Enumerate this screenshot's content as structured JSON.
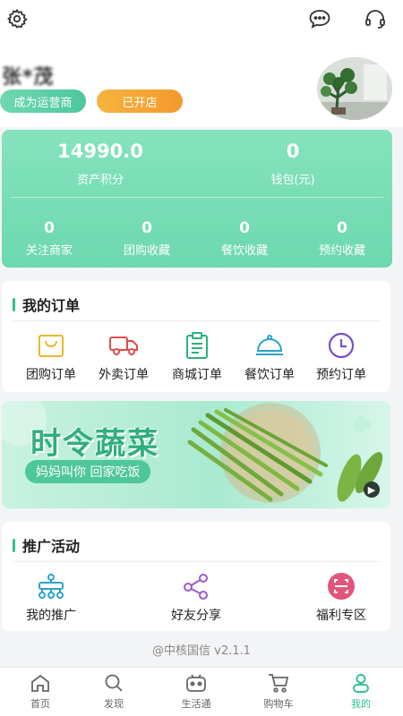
{
  "header": {
    "settings_icon": "gear-icon",
    "message_icon": "chat-bubble-icon",
    "service_icon": "headset-icon"
  },
  "profile": {
    "username": "张*茂",
    "operator_button": "成为运营商",
    "shop_button": "已开店",
    "avatar_icon": "avatar-photo"
  },
  "assets": {
    "points_value": "14990.0",
    "points_label": "资产积分",
    "wallet_value": "0",
    "wallet_label": "钱包(元)",
    "stats": [
      {
        "value": "0",
        "label": "关注商家"
      },
      {
        "value": "0",
        "label": "团购收藏"
      },
      {
        "value": "0",
        "label": "餐饮收藏"
      },
      {
        "value": "0",
        "label": "预约收藏"
      }
    ]
  },
  "orders": {
    "title": "我的订单",
    "items": [
      {
        "label": "团购订单",
        "icon": "shopping-bag-icon",
        "color": "#e8b82a"
      },
      {
        "label": "外卖订单",
        "icon": "delivery-truck-icon",
        "color": "#e24b4b"
      },
      {
        "label": "商城订单",
        "icon": "clipboard-icon",
        "color": "#2bb07b"
      },
      {
        "label": "餐饮订单",
        "icon": "food-cloche-icon",
        "color": "#2aa3c9"
      },
      {
        "label": "预约订单",
        "icon": "clock-icon",
        "color": "#7a4fd1"
      }
    ]
  },
  "banner": {
    "title": "时令蔬菜",
    "subtitle": "妈妈叫你 回家吃饭",
    "arrow_icon": "play-arrow-icon"
  },
  "promo": {
    "title": "推广活动",
    "items": [
      {
        "label": "我的推广",
        "icon": "network-icon",
        "color": "#2aa3c9"
      },
      {
        "label": "好友分享",
        "icon": "share-icon",
        "color": "#9b59d0"
      },
      {
        "label": "福利专区",
        "icon": "scan-icon",
        "color": "#e2557a"
      }
    ]
  },
  "footer": {
    "version": "@中核国信 v2.1.1"
  },
  "tabbar": {
    "items": [
      {
        "label": "首页",
        "icon": "home-icon"
      },
      {
        "label": "发现",
        "icon": "search-icon"
      },
      {
        "label": "生活通",
        "icon": "robot-icon"
      },
      {
        "label": "购物车",
        "icon": "cart-icon"
      },
      {
        "label": "我的",
        "icon": "user-icon"
      }
    ],
    "active_color": "#2ec28d"
  }
}
